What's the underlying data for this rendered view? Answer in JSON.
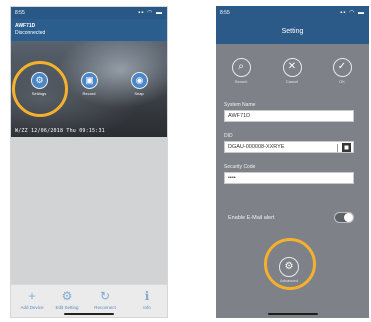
{
  "colors": {
    "accent": "#4b86c6",
    "header": "#2b5a89",
    "highlight_ring": "#f5b12e",
    "overlay": "#7e8288"
  },
  "left": {
    "status_time": "8:55",
    "device_name": "AWF71D",
    "device_state": "Disconnected",
    "camera_buttons": [
      {
        "label": "Settings",
        "icon": "gear-icon"
      },
      {
        "label": "Record",
        "icon": "record-icon"
      },
      {
        "label": "Snap",
        "icon": "camera-icon"
      }
    ],
    "timestamp": "W/ZZ 12/06/2018 Thu 09:15:31",
    "toolbar": [
      {
        "label": "Add Device",
        "icon": "plus-icon"
      },
      {
        "label": "Edit Setting",
        "icon": "gear-icon"
      },
      {
        "label": "Reconnect",
        "icon": "refresh-icon"
      },
      {
        "label": "Info",
        "icon": "info-icon"
      }
    ]
  },
  "right": {
    "status_time": "8:55",
    "title": "Setting",
    "actions": [
      {
        "label": "Search",
        "icon": "search-icon"
      },
      {
        "label": "Cancel",
        "icon": "close-icon"
      },
      {
        "label": "OK",
        "icon": "check-icon"
      }
    ],
    "fields": [
      {
        "label": "System Name",
        "value": "AWF71D"
      },
      {
        "label": "DID",
        "value": "DGAU-000008-XXRYE"
      },
      {
        "label": "Security Code",
        "value": "••••"
      }
    ],
    "email_alert_label": "Enable E-Mail alert",
    "email_alert_on": false,
    "advanced_label": "Advanced"
  }
}
